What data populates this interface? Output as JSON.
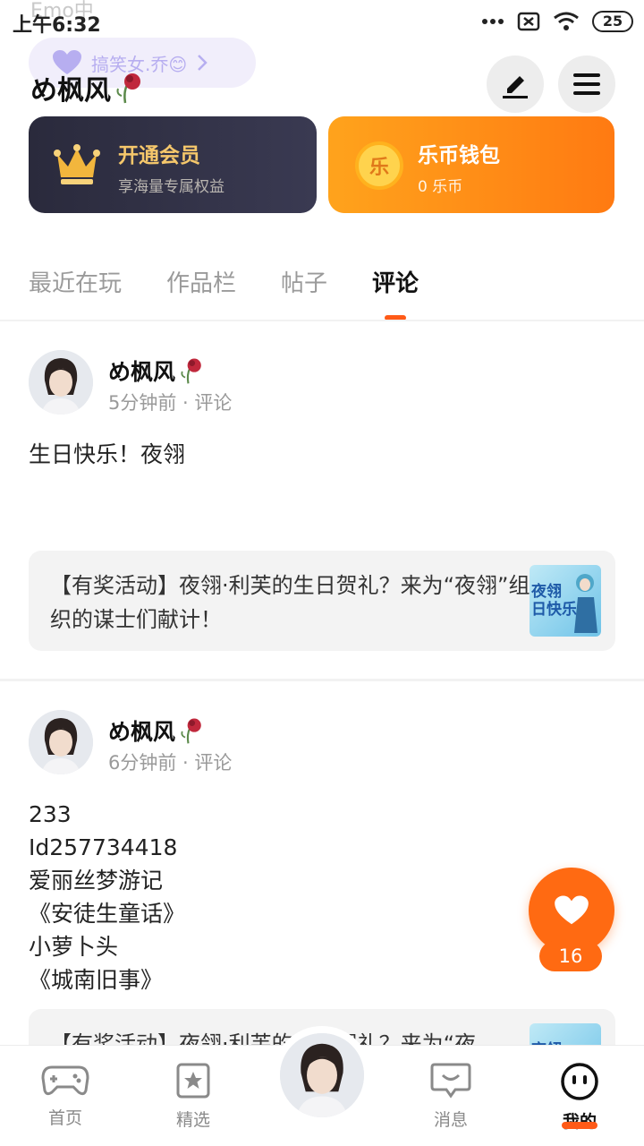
{
  "status_bar": {
    "ghost_text": "Emo中",
    "time": "上午6:32",
    "battery": "25",
    "icons": [
      "more-dots-icon",
      "sim-off-icon",
      "wifi-icon",
      "battery-icon"
    ]
  },
  "header": {
    "mood_text": "搞笑女.乔😊",
    "username": "め枫风",
    "username_decoration": "wilted-rose-icon",
    "edit_icon": "edit-icon",
    "menu_icon": "menu-icon"
  },
  "cards": {
    "vip": {
      "title": "开通会员",
      "subtitle": "享海量专属权益",
      "icon": "crown-icon"
    },
    "wallet": {
      "title": "乐币钱包",
      "subtitle": "0 乐币",
      "coin_char": "乐",
      "icon": "coin-icon"
    }
  },
  "tabs": [
    {
      "label": "最近在玩",
      "active": false
    },
    {
      "label": "作品栏",
      "active": false
    },
    {
      "label": "帖子",
      "active": false
    },
    {
      "label": "评论",
      "active": true
    }
  ],
  "posts": [
    {
      "author": "め枫风",
      "meta": "5分钟前 · 评论",
      "body": [
        "生日快乐！夜翎"
      ],
      "linked_title": "【有奖活动】夜翎·利芙的生日贺礼？来为“夜翎”组织的谋士们献计！",
      "thumb_text": [
        "夜翎",
        "日快乐"
      ]
    },
    {
      "author": "め枫风",
      "meta": "6分钟前 · 评论",
      "body": [
        "233",
        "Id257734418",
        "爱丽丝梦游记",
        "《安徒生童话》",
        "小萝卜头",
        "《城南旧事》"
      ],
      "linked_title": "【有奖活动】夜翎·利芙的生日贺礼？来为“夜",
      "thumb_text": [
        "夜翎",
        ""
      ]
    }
  ],
  "like": {
    "count": "16"
  },
  "bottom_nav": {
    "items": [
      {
        "label": "首页",
        "icon": "gamepad-icon",
        "active": false
      },
      {
        "label": "精选",
        "icon": "star-bookmark-icon",
        "active": false
      },
      {
        "label": "消息",
        "icon": "message-icon",
        "active": false
      },
      {
        "label": "我的",
        "icon": "face-icon",
        "active": true
      }
    ]
  },
  "colors": {
    "accent": "#ff5a17",
    "vip_bg": "#2a2a3c",
    "wallet_bg": "#ff8a12",
    "vip_gold": "#f5c76b"
  }
}
